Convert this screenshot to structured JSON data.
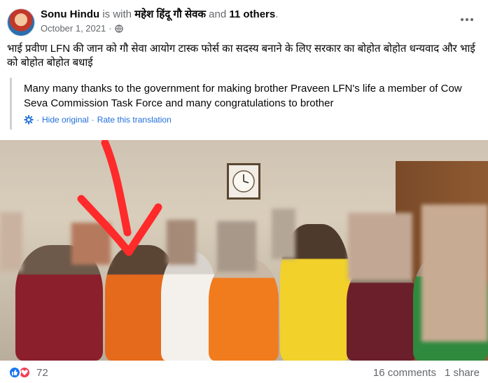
{
  "post": {
    "author": "Sonu Hindu",
    "with_text": "is with",
    "tagged_user": "महेश हिंदू गौ सेवक",
    "and_text": "and",
    "others": "11 others",
    "period": ".",
    "date": "October 1, 2021",
    "date_sep": "·",
    "privacy_icon": "globe-icon",
    "body": "भाई प्रवीण LFN की जान को गौ सेवा आयोग टास्क फोर्स का सदस्य बनाने के लिए सरकार का बोहोत बोहोत धन्यवाद और भाई को बोहोत बोहोत बधाई",
    "translation": "Many many thanks to the government for making brother Praveen LFN's life a member of Cow Seva Commission Task Force and many congratulations to brother",
    "hide_original": "Hide original",
    "link_sep": "·",
    "rate_translation": "Rate this translation"
  },
  "engagement": {
    "reaction_count": "72",
    "comments": "16 comments",
    "shares": "1 share"
  },
  "colors": {
    "link": "#216fdb",
    "muted": "#65676b",
    "like": "#1877f2",
    "love": "#f33e58",
    "arrow": "#ff2a2a"
  }
}
